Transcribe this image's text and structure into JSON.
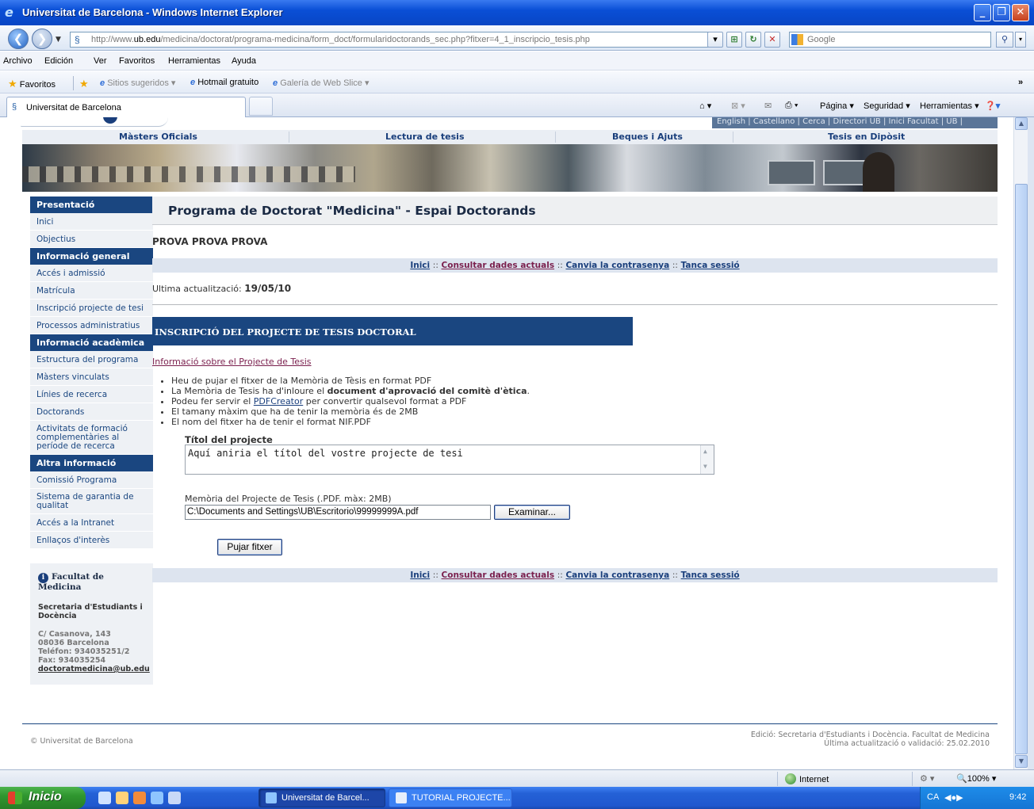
{
  "window": {
    "title": "Universitat de Barcelona - Windows Internet Explorer"
  },
  "addressbar": {
    "url_prefix": "http://www.",
    "url_host": "ub.edu",
    "url_path": "/medicina/doctorat/programa-medicina/form_doct/formularidoctorands_sec.php?fitxer=4_1_inscripcio_tesis.php",
    "search_placeholder": "Google"
  },
  "menubar": [
    "Archivo",
    "Edición",
    "Ver",
    "Favoritos",
    "Herramientas",
    "Ayuda"
  ],
  "favbar": {
    "favorites": "Favoritos",
    "suggested": "Sitios sugeridos",
    "hotmail": "Hotmail gratuito",
    "webslice": "Galería de Web Slice"
  },
  "tabs": {
    "active_tab": "Universitat de Barcelona",
    "page_menu": "Página",
    "safety_menu": "Seguridad",
    "tools_menu": "Herramientas"
  },
  "page": {
    "toplinks": "English | Castellano | Cerca | Directori UB | Inici Facultat | UB |",
    "sectionnav": [
      "Màsters Oficials",
      "Lectura de tesis",
      "Beques i Ajuts",
      "Tesis en Dipòsit"
    ],
    "sidebar": {
      "presentacio": "Presentació",
      "inici": "Inici",
      "objectius": "Objectius",
      "info_general": "Informació general",
      "acces": "Accés i admissió",
      "matricula": "Matrícula",
      "inscripcio": "Inscripció projecte de tesi",
      "processos": "Processos administratius",
      "info_academica": "Informació acadèmica",
      "estructura": "Estructura del programa",
      "masters": "Màsters vinculats",
      "linies": "Línies de recerca",
      "doctorands": "Doctorands",
      "activitats": "Activitats de formació complementàries al període de recerca",
      "altra_info": "Altra informació",
      "comissio": "Comissió Programa",
      "sistema": "Sistema de garantia de qualitat",
      "intranet": "Accés a la Intranet",
      "enllacos": "Enllaços d'interès"
    },
    "faculty": {
      "name": "Facultat de Medicina",
      "secretaria": "Secretaria d'Estudiants i Docència",
      "address1": "C/ Casanova, 143",
      "address2": "08036 Barcelona",
      "phone": "Teléfon: 934035251/2",
      "fax": "Fax: 934035254",
      "email": "doctoratmedicina@ub.edu"
    },
    "main": {
      "title": "Programa de Doctorat \"Medicina\" - Espai Doctorands",
      "user": "PROVA PROVA PROVA",
      "links": {
        "inici": "Inici",
        "consultar": "Consultar dades actuals",
        "canvia": "Canvia la contrasenya",
        "tanca": "Tanca sessió",
        "sep": "::"
      },
      "last_update_label": "Ultima actualització:",
      "last_update_value": "19/05/10",
      "section_header": "INSCRIPCIÓ DEL PROJECTE DE TESIS DOCTORAL",
      "info_link": "Informació sobre el Projecte de Tesis",
      "bullet1": "Heu de pujar el fitxer de la Memòria de Tèsis en format PDF",
      "bullet2_pre": "La Memòria de Tesis ha d'inloure el ",
      "bullet2_bold": "document d'aprovació del comitè d'ètica",
      "bullet2_post": ".",
      "bullet3_pre": "Podeu fer servir el ",
      "bullet3_link": "PDFCreator",
      "bullet3_post": " per convertir qualsevol format a PDF",
      "bullet4": "El tamany màxim que ha de tenir la memòria és de 2MB",
      "bullet5": "El nom del fitxer ha de tenir el format NIF.PDF",
      "title_label": "Títol del projecte",
      "title_value": "Aquí aniria el títol del vostre projecte de tesi",
      "file_label": "Memòria del Projecte de Tesis (.PDF. màx: 2MB)",
      "file_value": "C:\\Documents and Settings\\UB\\Escritorio\\99999999A.pdf",
      "browse_button": "Examinar...",
      "upload_button": "Pujar fitxer"
    },
    "footer": {
      "copyright": "© Universitat de Barcelona",
      "edition": "Edició: Secretaria d'Estudiants i Docència. Facultat de Medicina",
      "validation": "Última actualització o validació: 25.02.2010"
    }
  },
  "statusbar": {
    "zone": "Internet",
    "zoom": "100%"
  },
  "taskbar": {
    "start": "Inicio",
    "task1": "Universitat de Barcel...",
    "task2": "TUTORIAL PROJECTE...",
    "lang": "CA",
    "time": "9:42"
  }
}
